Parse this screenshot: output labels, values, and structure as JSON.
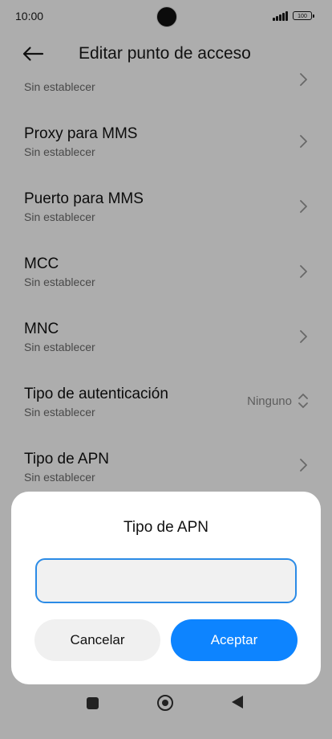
{
  "status_bar": {
    "time": "10:00",
    "battery": "100"
  },
  "header": {
    "title": "Editar punto de acceso"
  },
  "rows": [
    {
      "title": "",
      "subtitle": "Sin establecer"
    },
    {
      "title": "Proxy para MMS",
      "subtitle": "Sin establecer"
    },
    {
      "title": "Puerto para MMS",
      "subtitle": "Sin establecer"
    },
    {
      "title": "MCC",
      "subtitle": "Sin establecer"
    },
    {
      "title": "MNC",
      "subtitle": "Sin establecer"
    },
    {
      "title": "Tipo de autenticación",
      "subtitle": "Sin establecer",
      "value": "Ninguno"
    },
    {
      "title": "Tipo de APN",
      "subtitle": "Sin establecer"
    }
  ],
  "dialog": {
    "title": "Tipo de APN",
    "input_value": "",
    "cancel_label": "Cancelar",
    "ok_label": "Aceptar"
  },
  "colors": {
    "accent": "#0d84ff",
    "input_border": "#2b8be6",
    "scrim": "rgba(0,0,0,0.32)"
  },
  "icons": [
    "back-arrow-icon",
    "chevron-right-icon",
    "unfold-icon",
    "recent-apps-icon",
    "home-icon",
    "back-triangle-icon"
  ]
}
